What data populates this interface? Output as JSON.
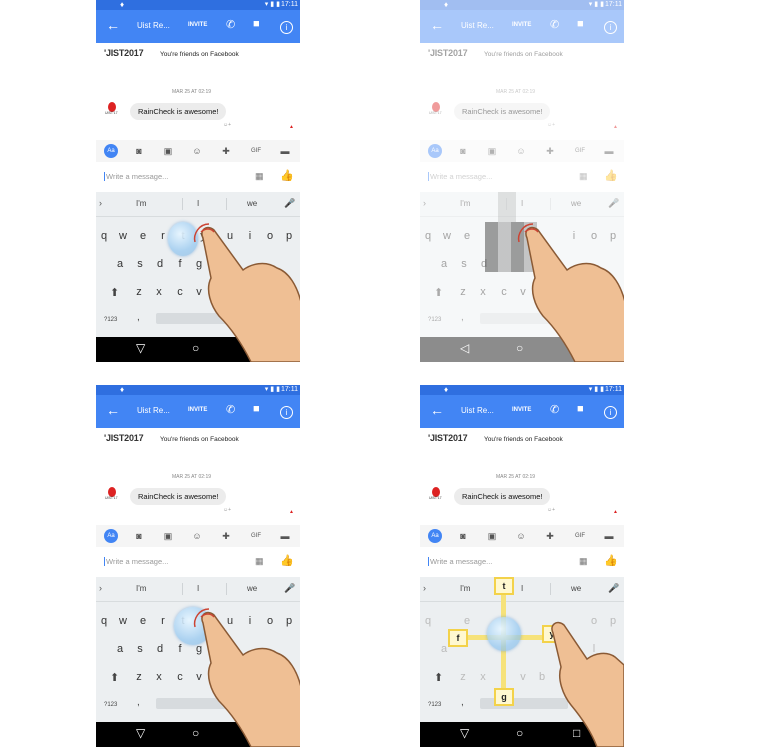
{
  "status": {
    "time": "17:11"
  },
  "appbar": {
    "title": "Uist Re...",
    "invite": "INVITE"
  },
  "chat": {
    "logo": "'JIST2017",
    "friends": "You're friends on Facebook",
    "date": "MAR 25 AT 02:19",
    "avatar_tag": "UIST'17",
    "message": "RainCheck is awesome!"
  },
  "composer": {
    "placeholder": "Write a message...",
    "aa_label": "Aa",
    "gif_label": "GIF"
  },
  "keyboard": {
    "suggestions": [
      "I'm",
      "I",
      "we"
    ],
    "row1": [
      "q",
      "w",
      "e",
      "r",
      "t",
      "y",
      "u",
      "i",
      "o",
      "p"
    ],
    "row2": [
      "a",
      "s",
      "d",
      "f",
      "g",
      "h",
      "j",
      "k",
      "l"
    ],
    "row3": [
      "z",
      "x",
      "c",
      "v",
      "b",
      "n",
      "m"
    ],
    "numbers_key": "?123",
    "comma": ",",
    "period": "."
  },
  "tilt_labels": {
    "up": "t",
    "left": "f",
    "right": "y",
    "down": "g"
  },
  "accent_color": "#4285f4",
  "highlight_color": "#f6e27a"
}
